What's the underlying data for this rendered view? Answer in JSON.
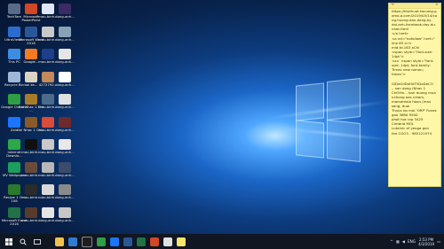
{
  "desktop_icons": [
    {
      "label": "TechTam",
      "color": "#5a6b8a"
    },
    {
      "label": "Microsoft PowerPoint",
      "color": "#d24726"
    },
    {
      "label": "mau-binh...",
      "color": "#dfe7f5"
    },
    {
      "label": "dong-anh...",
      "color": "#3b2a64"
    },
    {
      "label": "UltraViewer",
      "color": "#2d6ccf"
    },
    {
      "label": "Microsoft Word 2016",
      "color": "#2b579a"
    },
    {
      "label": "mau-binh...",
      "color": "#c8c8c8"
    },
    {
      "label": "dong-anh...",
      "color": "#88a3b8"
    },
    {
      "label": "This PC",
      "color": "#3d8ee0"
    },
    {
      "label": "Google...",
      "color": "#f47b20"
    },
    {
      "label": "mau-binh...",
      "color": "#1f3f8a"
    },
    {
      "label": "dong-anh...",
      "color": "#e6e6e6"
    },
    {
      "label": "Recycle Bin",
      "color": "#9fb8d6"
    },
    {
      "label": "bai ke...",
      "color": "#dcd3c5"
    },
    {
      "label": "4272792...",
      "color": "#c28a5b"
    },
    {
      "label": "dong-anh...",
      "color": "#ffffff"
    },
    {
      "label": "Google Chrome",
      "color": "#2f9e44"
    },
    {
      "label": "Bai Nhac 1 Chi ...",
      "color": "#a87b2a"
    },
    {
      "label": "mau-binh...",
      "color": "#4d6b8c"
    },
    {
      "label": "dong-anh...",
      "color": "#e0e0e0"
    },
    {
      "label": "Zalo",
      "color": "#1a75ff"
    },
    {
      "label": "Bai Nhac 1 Chi...",
      "color": "#8a5a2b"
    },
    {
      "label": "mau-binh...",
      "color": "#d94b3b"
    },
    {
      "label": "dong-anh...",
      "color": "#6d2b2b"
    },
    {
      "label": "Internet Downlo...",
      "color": "#2aa84a"
    },
    {
      "label": "mau-binh...",
      "color": "#101010"
    },
    {
      "label": "mau-binh...",
      "color": "#c9c9c9"
    },
    {
      "label": "dong-anh...",
      "color": "#e8e8e8"
    },
    {
      "label": "MV Wallpaper",
      "color": "#1e9e5c"
    },
    {
      "label": "mau-binh...",
      "color": "#6a4b3a"
    },
    {
      "label": "mau-binh...",
      "color": "#b8b8b8"
    },
    {
      "label": "dong-anh...",
      "color": "#3a4b6b"
    },
    {
      "label": "Recipe 1 Chi 108",
      "color": "#2b7a2b"
    },
    {
      "label": "mau-binh...",
      "color": "#2b2b2b"
    },
    {
      "label": "mau-binh...",
      "color": "#d8d8d8"
    },
    {
      "label": "dong-anh...",
      "color": "#8a8a8a"
    },
    {
      "label": "Microsoft Excel 2016",
      "color": "#217346"
    },
    {
      "label": "mau-binh...",
      "color": "#5a3b2b"
    },
    {
      "label": "dong-anh...",
      "color": "#e5e5e5"
    },
    {
      "label": "dong-anh...",
      "color": "#c7c7c7"
    }
  ],
  "note": {
    "text": "https://thuthuat.ttocong.gomo.o.com/2019/03/14/cong-huong-dan-dang-ky-doi-anh-facebook-day-du-nhat.html\n</a href>\n<a rel=\"nofollow\" href=\"\nline 65 in tr\nmid.td.163 aChl\n<span style=\"font-size: 14pt\">\n<a> <span style=\"font-size: 14pt; font-family: Times new roman; times\">\n\nGiDaGilDaHdT5DaDaCO\n-. san dong (Nhac 1 Chi5Hn... ban duong mua s.thong aas cream, mamamaia hoon (mau sang, duoi\nThuoc bo moi 'ORP' Fonex gao 3680 9500\nphat hoc lop 3425\nCimbrid MOL\nLuteinic ef yeoga gon\nthe CGO3 - 985121974"
  },
  "taskbar": {
    "clock_time": "2:53 PM",
    "clock_date": "4/3/2019",
    "language": "ENG"
  }
}
